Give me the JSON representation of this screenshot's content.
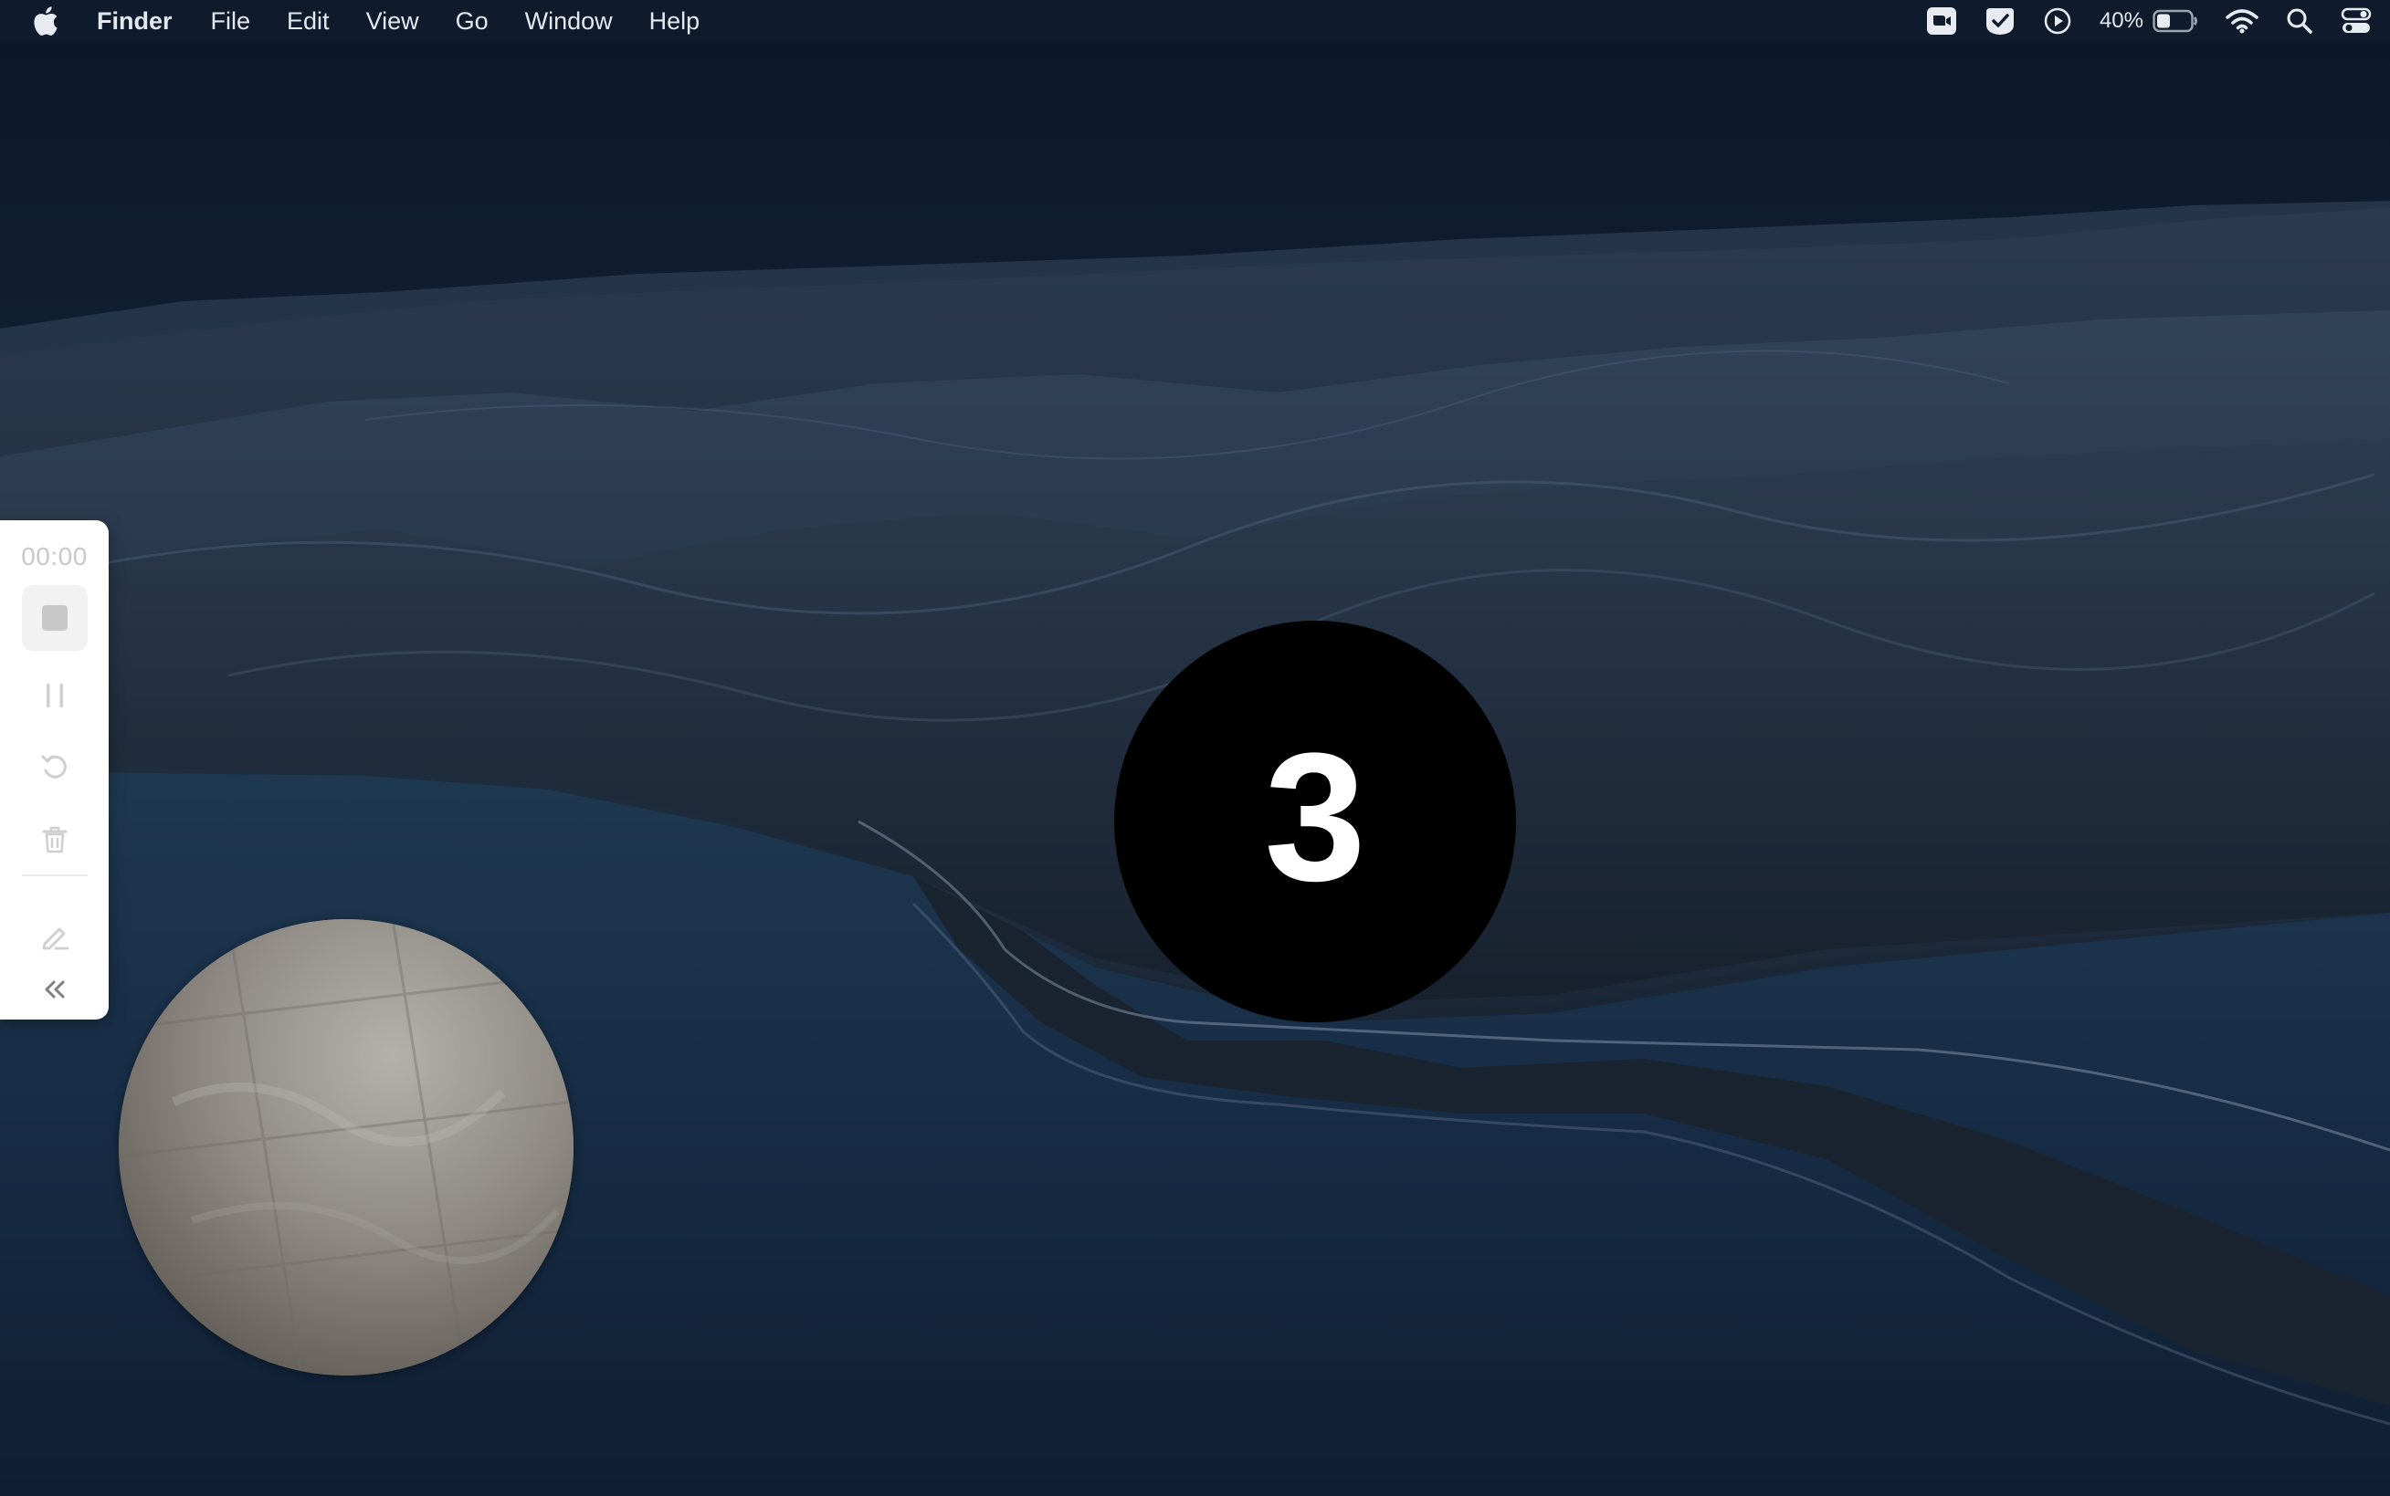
{
  "menubar": {
    "app_name": "Finder",
    "menus": [
      "File",
      "Edit",
      "View",
      "Go",
      "Window",
      "Help"
    ],
    "battery_percent": "40%",
    "battery_level": 0.4,
    "status_icons": [
      "screen-recorder-icon",
      "checkmark-app-icon",
      "play-circle-icon",
      "battery-icon",
      "wifi-icon",
      "spotlight-search-icon",
      "control-center-icon"
    ]
  },
  "recorder": {
    "timer": "00:00",
    "buttons": [
      "stop-icon",
      "pause-icon",
      "restart-icon",
      "trash-icon",
      "pen-icon",
      "collapse-chevrons-icon"
    ]
  },
  "countdown": {
    "value": "3"
  },
  "colors": {
    "menubar_bg": "#101c2e",
    "toolbar_bg": "#ffffff",
    "countdown_bg": "#000000",
    "countdown_text": "#ffffff"
  }
}
